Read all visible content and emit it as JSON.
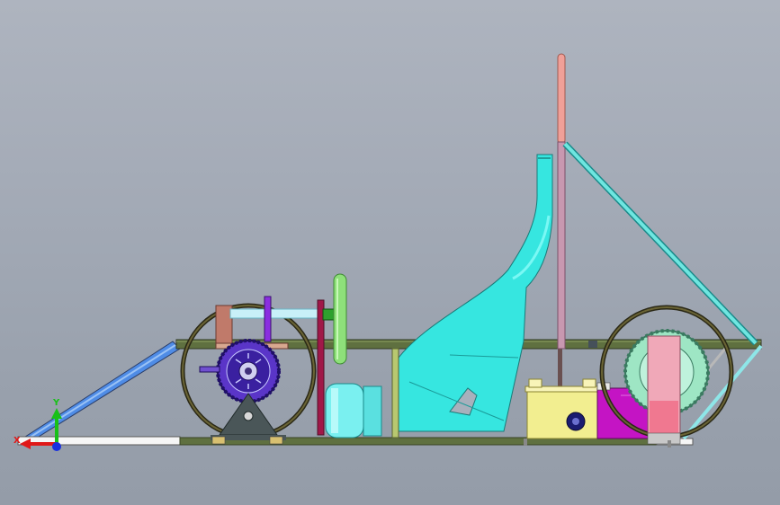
{
  "viewport": {
    "background_top": "#aeb4bf",
    "background_bottom": "#949ca8"
  },
  "triad": {
    "x_label": "X",
    "y_label": "Y",
    "x_color": "#e01818",
    "y_color": "#18c018",
    "z_color": "#1830e0"
  },
  "parts": [
    {
      "name": "chassis-frame-rail",
      "color": "#5f7040"
    },
    {
      "name": "seat-shell",
      "color": "#36e6e0"
    },
    {
      "name": "rollbar-upright",
      "color": "#b88aa0"
    },
    {
      "name": "rollbar-brace",
      "color": "#6ee6e0"
    },
    {
      "name": "front-wheel",
      "color": "#5c5630"
    },
    {
      "name": "rear-wheel",
      "color": "#5c5630"
    },
    {
      "name": "front-sprocket",
      "color": "#5a35c8"
    },
    {
      "name": "rear-sprocket",
      "color": "#9ee6c4"
    },
    {
      "name": "steering-wheel",
      "color": "#8ee07a"
    },
    {
      "name": "fuel-tank",
      "color": "#f2ee90"
    },
    {
      "name": "battery-box",
      "color": "#c414c4"
    },
    {
      "name": "axle-mount-plate",
      "color": "#f0a8b8"
    }
  ]
}
